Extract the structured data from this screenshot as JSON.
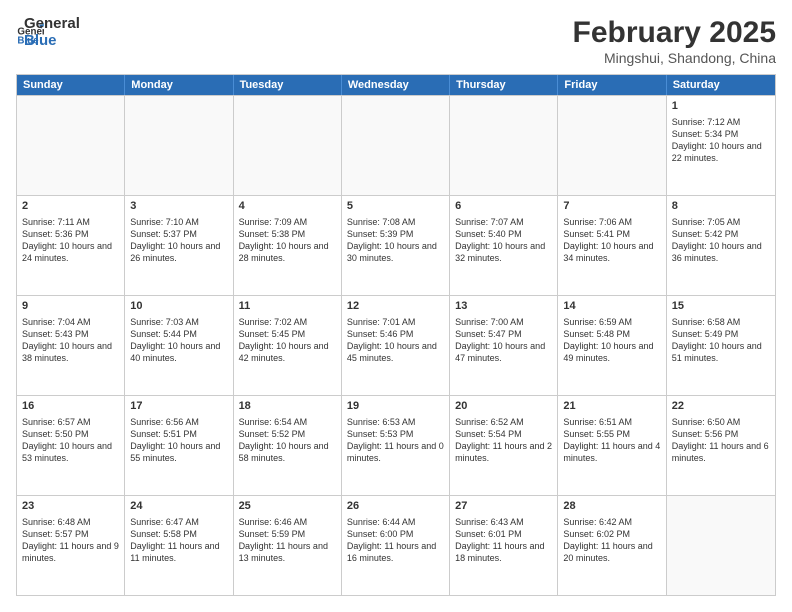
{
  "header": {
    "logo_general": "General",
    "logo_blue": "Blue",
    "month_year": "February 2025",
    "location": "Mingshui, Shandong, China"
  },
  "days_of_week": [
    "Sunday",
    "Monday",
    "Tuesday",
    "Wednesday",
    "Thursday",
    "Friday",
    "Saturday"
  ],
  "weeks": [
    [
      {
        "day": "",
        "info": "",
        "empty": true
      },
      {
        "day": "",
        "info": "",
        "empty": true
      },
      {
        "day": "",
        "info": "",
        "empty": true
      },
      {
        "day": "",
        "info": "",
        "empty": true
      },
      {
        "day": "",
        "info": "",
        "empty": true
      },
      {
        "day": "",
        "info": "",
        "empty": true
      },
      {
        "day": "1",
        "info": "Sunrise: 7:12 AM\nSunset: 5:34 PM\nDaylight: 10 hours and 22 minutes."
      }
    ],
    [
      {
        "day": "2",
        "info": "Sunrise: 7:11 AM\nSunset: 5:36 PM\nDaylight: 10 hours and 24 minutes."
      },
      {
        "day": "3",
        "info": "Sunrise: 7:10 AM\nSunset: 5:37 PM\nDaylight: 10 hours and 26 minutes."
      },
      {
        "day": "4",
        "info": "Sunrise: 7:09 AM\nSunset: 5:38 PM\nDaylight: 10 hours and 28 minutes."
      },
      {
        "day": "5",
        "info": "Sunrise: 7:08 AM\nSunset: 5:39 PM\nDaylight: 10 hours and 30 minutes."
      },
      {
        "day": "6",
        "info": "Sunrise: 7:07 AM\nSunset: 5:40 PM\nDaylight: 10 hours and 32 minutes."
      },
      {
        "day": "7",
        "info": "Sunrise: 7:06 AM\nSunset: 5:41 PM\nDaylight: 10 hours and 34 minutes."
      },
      {
        "day": "8",
        "info": "Sunrise: 7:05 AM\nSunset: 5:42 PM\nDaylight: 10 hours and 36 minutes."
      }
    ],
    [
      {
        "day": "9",
        "info": "Sunrise: 7:04 AM\nSunset: 5:43 PM\nDaylight: 10 hours and 38 minutes."
      },
      {
        "day": "10",
        "info": "Sunrise: 7:03 AM\nSunset: 5:44 PM\nDaylight: 10 hours and 40 minutes."
      },
      {
        "day": "11",
        "info": "Sunrise: 7:02 AM\nSunset: 5:45 PM\nDaylight: 10 hours and 42 minutes."
      },
      {
        "day": "12",
        "info": "Sunrise: 7:01 AM\nSunset: 5:46 PM\nDaylight: 10 hours and 45 minutes."
      },
      {
        "day": "13",
        "info": "Sunrise: 7:00 AM\nSunset: 5:47 PM\nDaylight: 10 hours and 47 minutes."
      },
      {
        "day": "14",
        "info": "Sunrise: 6:59 AM\nSunset: 5:48 PM\nDaylight: 10 hours and 49 minutes."
      },
      {
        "day": "15",
        "info": "Sunrise: 6:58 AM\nSunset: 5:49 PM\nDaylight: 10 hours and 51 minutes."
      }
    ],
    [
      {
        "day": "16",
        "info": "Sunrise: 6:57 AM\nSunset: 5:50 PM\nDaylight: 10 hours and 53 minutes."
      },
      {
        "day": "17",
        "info": "Sunrise: 6:56 AM\nSunset: 5:51 PM\nDaylight: 10 hours and 55 minutes."
      },
      {
        "day": "18",
        "info": "Sunrise: 6:54 AM\nSunset: 5:52 PM\nDaylight: 10 hours and 58 minutes."
      },
      {
        "day": "19",
        "info": "Sunrise: 6:53 AM\nSunset: 5:53 PM\nDaylight: 11 hours and 0 minutes."
      },
      {
        "day": "20",
        "info": "Sunrise: 6:52 AM\nSunset: 5:54 PM\nDaylight: 11 hours and 2 minutes."
      },
      {
        "day": "21",
        "info": "Sunrise: 6:51 AM\nSunset: 5:55 PM\nDaylight: 11 hours and 4 minutes."
      },
      {
        "day": "22",
        "info": "Sunrise: 6:50 AM\nSunset: 5:56 PM\nDaylight: 11 hours and 6 minutes."
      }
    ],
    [
      {
        "day": "23",
        "info": "Sunrise: 6:48 AM\nSunset: 5:57 PM\nDaylight: 11 hours and 9 minutes."
      },
      {
        "day": "24",
        "info": "Sunrise: 6:47 AM\nSunset: 5:58 PM\nDaylight: 11 hours and 11 minutes."
      },
      {
        "day": "25",
        "info": "Sunrise: 6:46 AM\nSunset: 5:59 PM\nDaylight: 11 hours and 13 minutes."
      },
      {
        "day": "26",
        "info": "Sunrise: 6:44 AM\nSunset: 6:00 PM\nDaylight: 11 hours and 16 minutes."
      },
      {
        "day": "27",
        "info": "Sunrise: 6:43 AM\nSunset: 6:01 PM\nDaylight: 11 hours and 18 minutes."
      },
      {
        "day": "28",
        "info": "Sunrise: 6:42 AM\nSunset: 6:02 PM\nDaylight: 11 hours and 20 minutes."
      },
      {
        "day": "",
        "info": "",
        "empty": true
      }
    ]
  ]
}
